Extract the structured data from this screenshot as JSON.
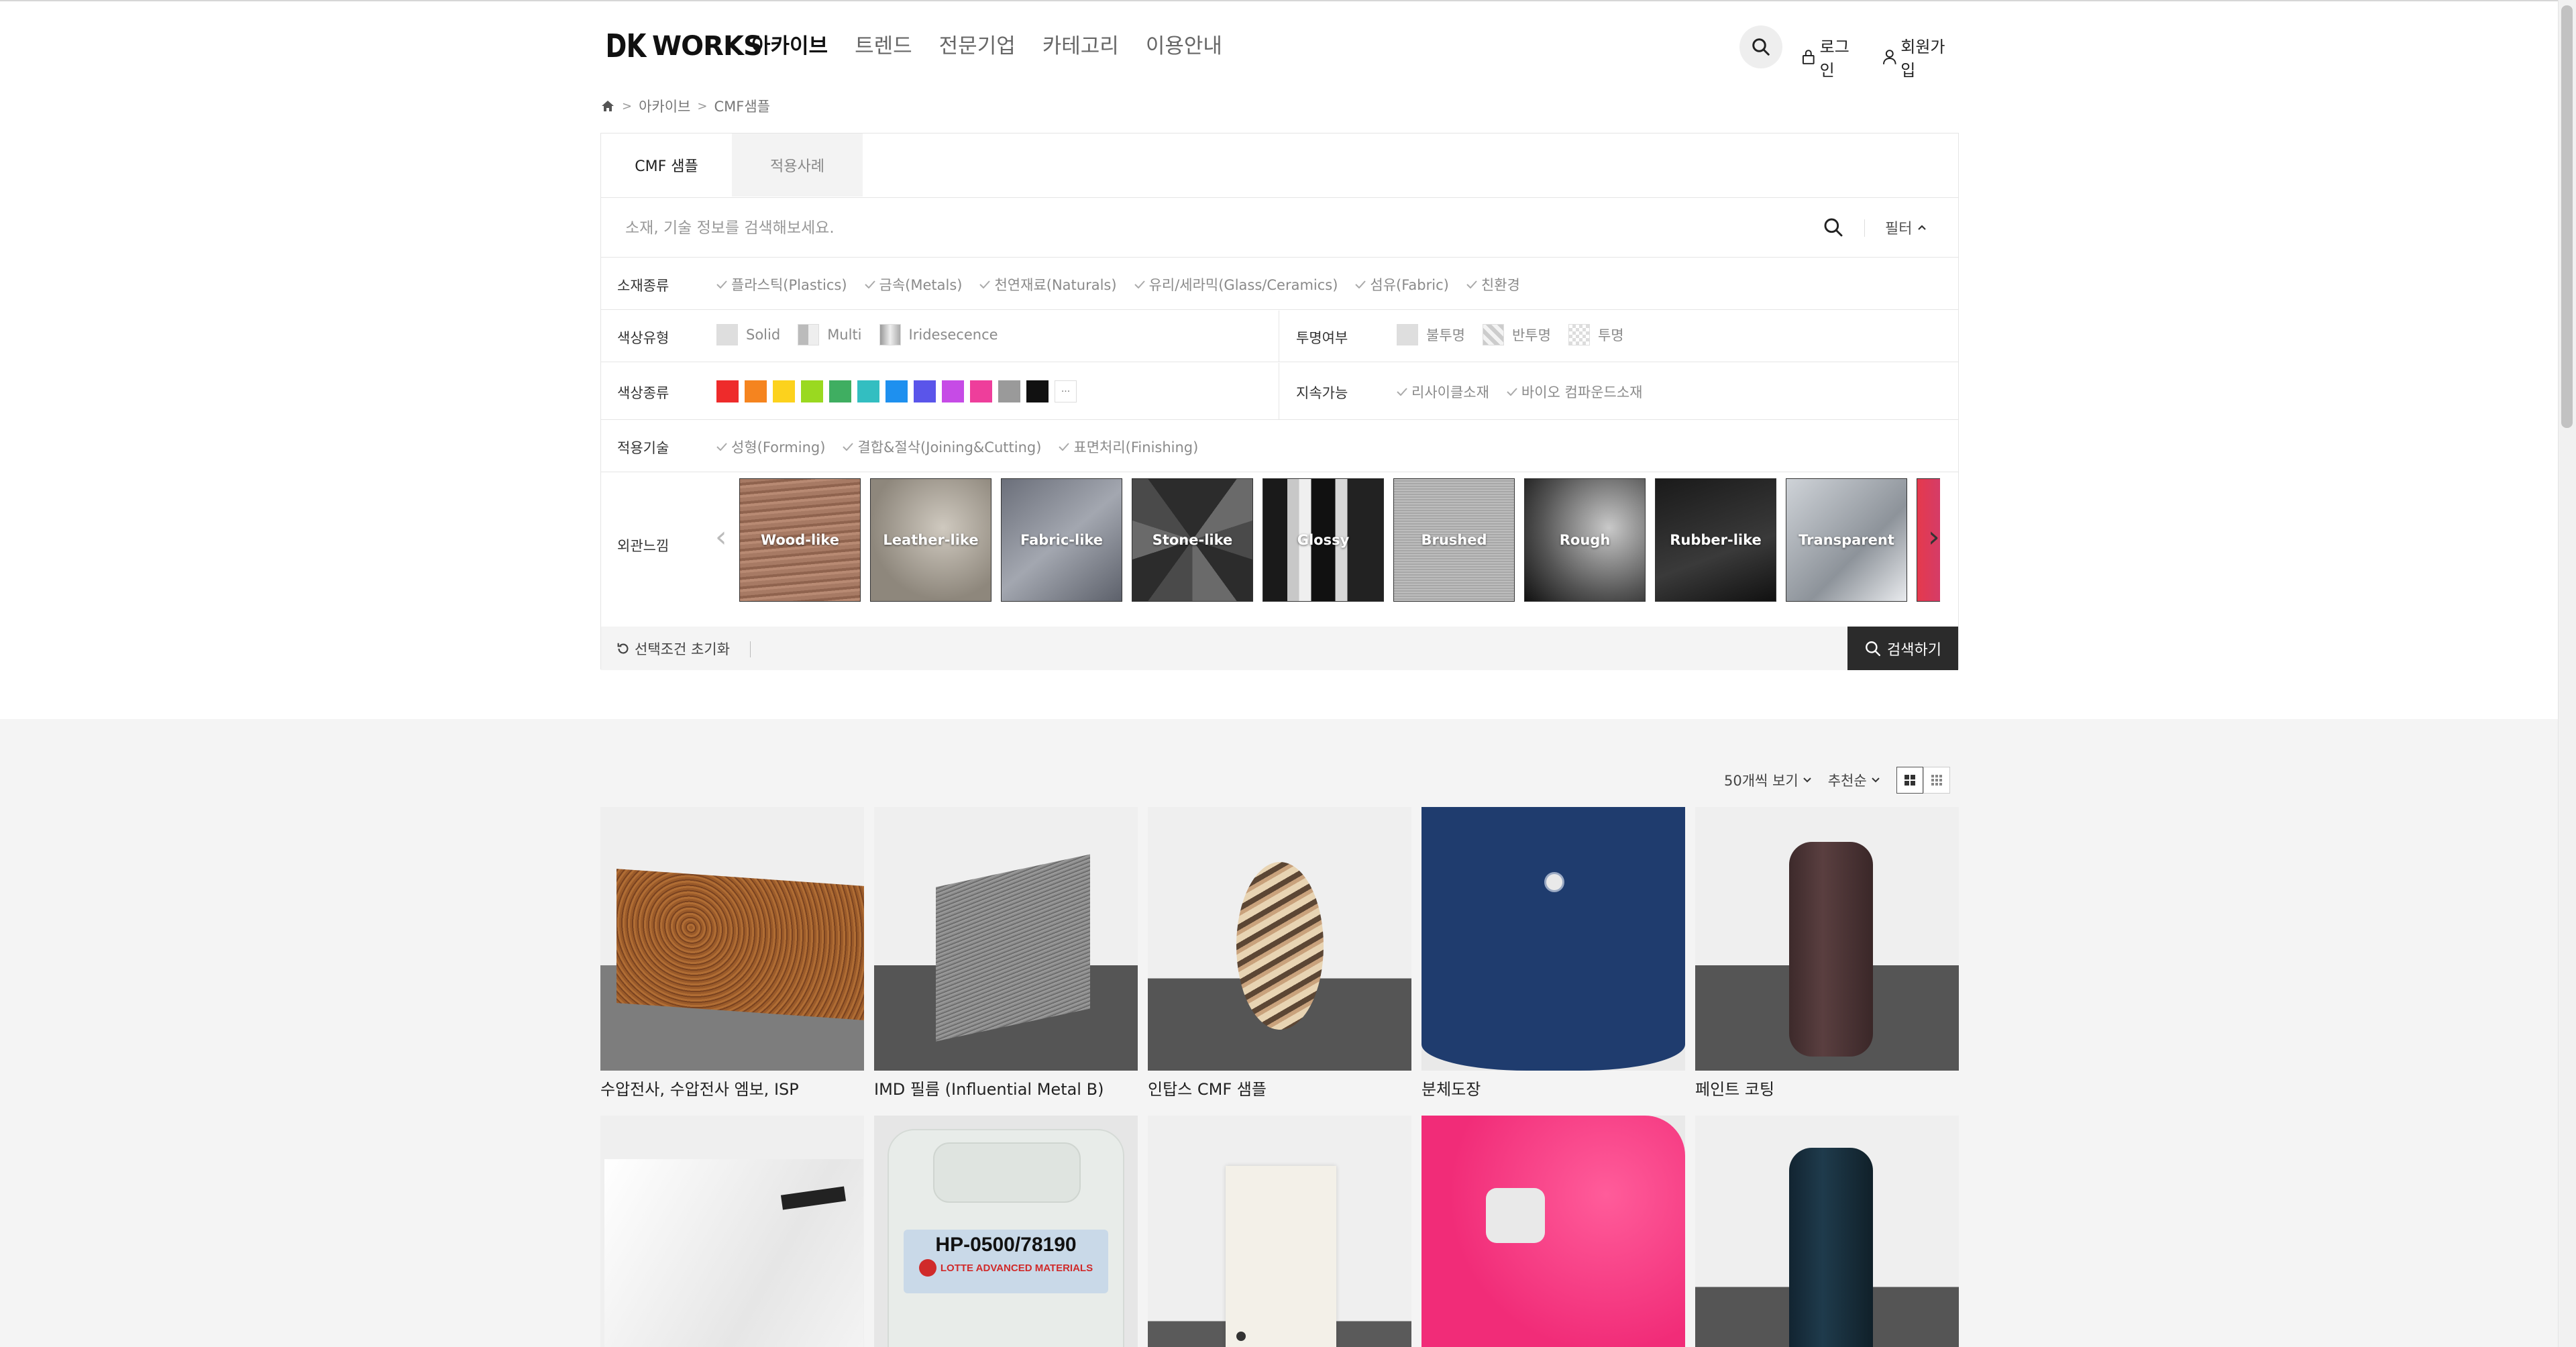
{
  "header": {
    "logo_text": "WORKS",
    "logo_mark": "DK",
    "nav": [
      "아카이브",
      "트렌드",
      "전문기업",
      "카테고리",
      "이용안내"
    ],
    "active_nav": "아카이브",
    "login": "로그인",
    "signup": "회원가입",
    "icons": {
      "search": "search-icon",
      "login": "lock-icon",
      "signup": "user-icon"
    }
  },
  "breadcrumb": {
    "home_icon": "home-icon",
    "items": [
      "아카이브",
      "CMF샘플"
    ]
  },
  "tabs": [
    "CMF 샘플",
    "적용사례"
  ],
  "search": {
    "placeholder": "소재, 기술 정보를 검색해보세요.",
    "filter_label": "필터"
  },
  "filters": {
    "material": {
      "label": "소재종류",
      "options": [
        "플라스틱(Plastics)",
        "금속(Metals)",
        "천연재료(Naturals)",
        "유리/세라믹(Glass/Ceramics)",
        "섬유(Fabric)",
        "친환경"
      ]
    },
    "color_type": {
      "label": "색상유형",
      "options": [
        "Solid",
        "Multi",
        "Iridesecence"
      ]
    },
    "transparency": {
      "label": "투명여부",
      "options": [
        "불투명",
        "반투명",
        "투명"
      ]
    },
    "color": {
      "label": "색상종류",
      "swatches": [
        "#ee2b2b",
        "#f5841f",
        "#fcd21d",
        "#9ad920",
        "#3fae61",
        "#33bec1",
        "#1e90ef",
        "#5a55ea",
        "#c64be6",
        "#ee3e9b",
        "#9a9a9a",
        "#111111"
      ],
      "more": "···"
    },
    "sustainable": {
      "label": "지속가능",
      "options": [
        "리사이클소재",
        "바이오 컴파운드소재"
      ]
    },
    "technique": {
      "label": "적용기술",
      "options": [
        "성형(Forming)",
        "결합&절삭(Joining&Cutting)",
        "표면처리(Finishing)"
      ]
    },
    "texture": {
      "label": "외관느낌",
      "items": [
        "Wood-like",
        "Leather-like",
        "Fabric-like",
        "Stone-like",
        "Glossy",
        "Brushed",
        "Rough",
        "Rubber-like",
        "Transparent",
        ""
      ]
    }
  },
  "actions": {
    "reset": "선택조건 초기화",
    "search": "검색하기"
  },
  "toolbar": {
    "per_page": "50개씩 보기",
    "sort": "추천순"
  },
  "products": [
    {
      "title": "수압전사, 수압전사 엠보, ISP"
    },
    {
      "title": "IMD 필름 (Influential Metal B)"
    },
    {
      "title": "인탑스 CMF 샘플"
    },
    {
      "title": "분체도장"
    },
    {
      "title": "페인트 코팅"
    },
    {
      "title": ""
    },
    {
      "title": "",
      "label_text": "HP-0500/78190",
      "brand": "LOTTE ADVANCED MATERIALS"
    },
    {
      "title": ""
    },
    {
      "title": ""
    },
    {
      "title": ""
    }
  ]
}
